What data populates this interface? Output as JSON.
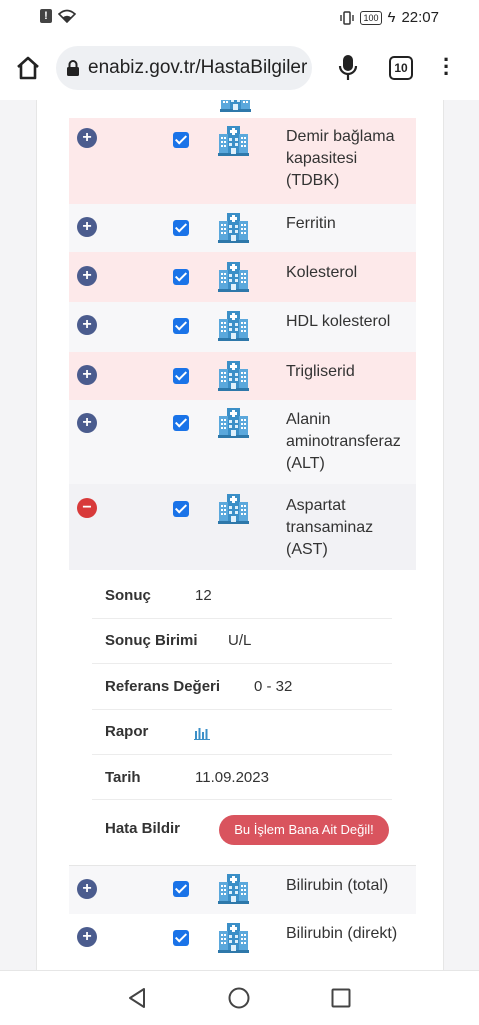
{
  "status": {
    "time": "22:07",
    "battery": "100"
  },
  "browser": {
    "url": "enabiz.gov.tr/HastaBilgiler",
    "tab_count": "10"
  },
  "tests": [
    {
      "name": "Demir bağlama kapasitesi (TDBK)",
      "checked": true,
      "expanded": false
    },
    {
      "name": "Ferritin",
      "checked": true,
      "expanded": false
    },
    {
      "name": "Kolesterol",
      "checked": true,
      "expanded": false
    },
    {
      "name": "HDL kolesterol",
      "checked": true,
      "expanded": false
    },
    {
      "name": "Trigliserid",
      "checked": true,
      "expanded": false
    },
    {
      "name": "Alanin aminotransferaz (ALT)",
      "checked": true,
      "expanded": false
    },
    {
      "name": "Aspartat transaminaz (AST)",
      "checked": true,
      "expanded": true
    },
    {
      "name": "Bilirubin (total)",
      "checked": true,
      "expanded": false
    },
    {
      "name": "Bilirubin (direkt)",
      "checked": true,
      "expanded": false
    }
  ],
  "details": {
    "result_label": "Sonuç",
    "result_value": "12",
    "unit_label": "Sonuç Birimi",
    "unit_value": "U/L",
    "ref_label": "Referans Değeri",
    "ref_value": "0 - 32",
    "report_label": "Rapor",
    "report_icon": "bar-chart-icon",
    "date_label": "Tarih",
    "date_value": "11.09.2023",
    "error_label": "Hata Bildir",
    "error_button": "Bu İşlem Bana Ait Değil!"
  },
  "colors": {
    "accent": "#1a73e8",
    "pink_row": "#fde9ea",
    "plus": "#4b5c8e",
    "minus": "#d83a3a",
    "error_btn": "#d9545e",
    "icon": "#3b8fc7"
  }
}
